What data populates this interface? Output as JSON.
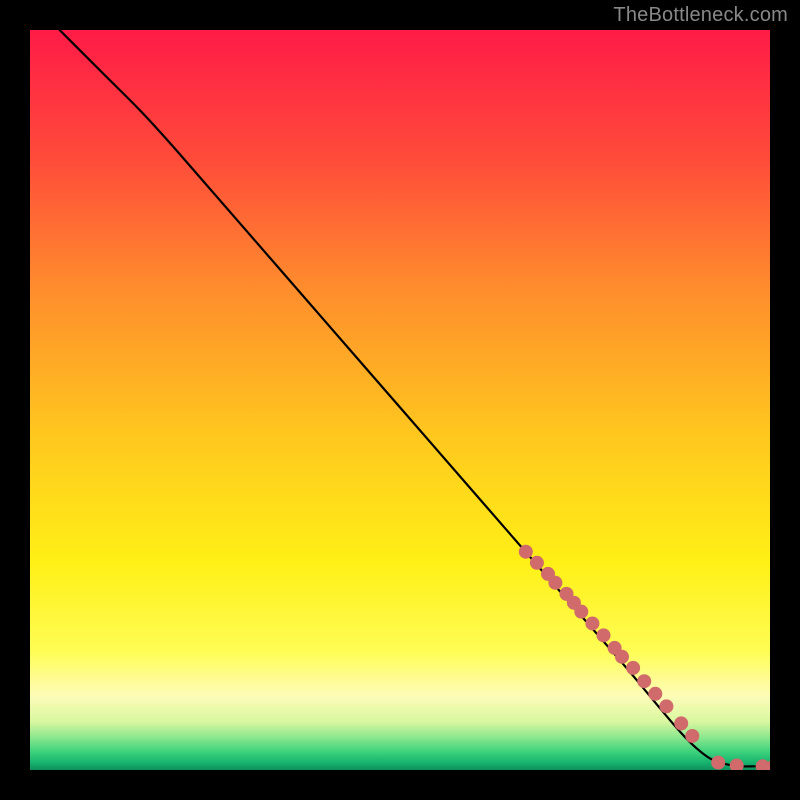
{
  "watermark": "TheBottleneck.com",
  "chart_data": {
    "type": "line",
    "title": "",
    "xlabel": "",
    "ylabel": "",
    "xlim": [
      0,
      100
    ],
    "ylim": [
      0,
      100
    ],
    "grid": false,
    "curve": {
      "name": "bottleneck-curve",
      "x": [
        4,
        6,
        10,
        15,
        20,
        30,
        40,
        50,
        60,
        70,
        80,
        85,
        88,
        90,
        92,
        94,
        96,
        98,
        100
      ],
      "y": [
        100,
        98,
        94,
        89,
        83.5,
        72,
        60.5,
        49,
        37.5,
        26,
        14.5,
        8.5,
        5,
        3,
        1.5,
        0.8,
        0.5,
        0.5,
        0.5
      ]
    },
    "markers": {
      "name": "data-points",
      "color": "#d16a6a",
      "radius_px": 7,
      "x": [
        67,
        68.5,
        70,
        71,
        72.5,
        73.5,
        74.5,
        76,
        77.5,
        79,
        80,
        81.5,
        83,
        84.5,
        86,
        88,
        89.5,
        93,
        95.5,
        99,
        100.5
      ],
      "y": [
        29.5,
        28,
        26.5,
        25.3,
        23.8,
        22.6,
        21.4,
        19.8,
        18.2,
        16.5,
        15.3,
        13.8,
        12.0,
        10.3,
        8.6,
        6.3,
        4.6,
        1.0,
        0.6,
        0.5,
        0.5
      ]
    },
    "gradient_stops": [
      {
        "offset": 0.0,
        "color": "#ff1b47"
      },
      {
        "offset": 0.17,
        "color": "#ff4a3a"
      },
      {
        "offset": 0.35,
        "color": "#ff8d2d"
      },
      {
        "offset": 0.55,
        "color": "#ffc81e"
      },
      {
        "offset": 0.72,
        "color": "#fff016"
      },
      {
        "offset": 0.84,
        "color": "#fffd55"
      },
      {
        "offset": 0.9,
        "color": "#fdfcb8"
      },
      {
        "offset": 0.935,
        "color": "#d8f7a0"
      },
      {
        "offset": 0.955,
        "color": "#8fe88f"
      },
      {
        "offset": 0.975,
        "color": "#3fd37d"
      },
      {
        "offset": 0.99,
        "color": "#16b36f"
      },
      {
        "offset": 1.0,
        "color": "#0e8f5a"
      }
    ]
  }
}
